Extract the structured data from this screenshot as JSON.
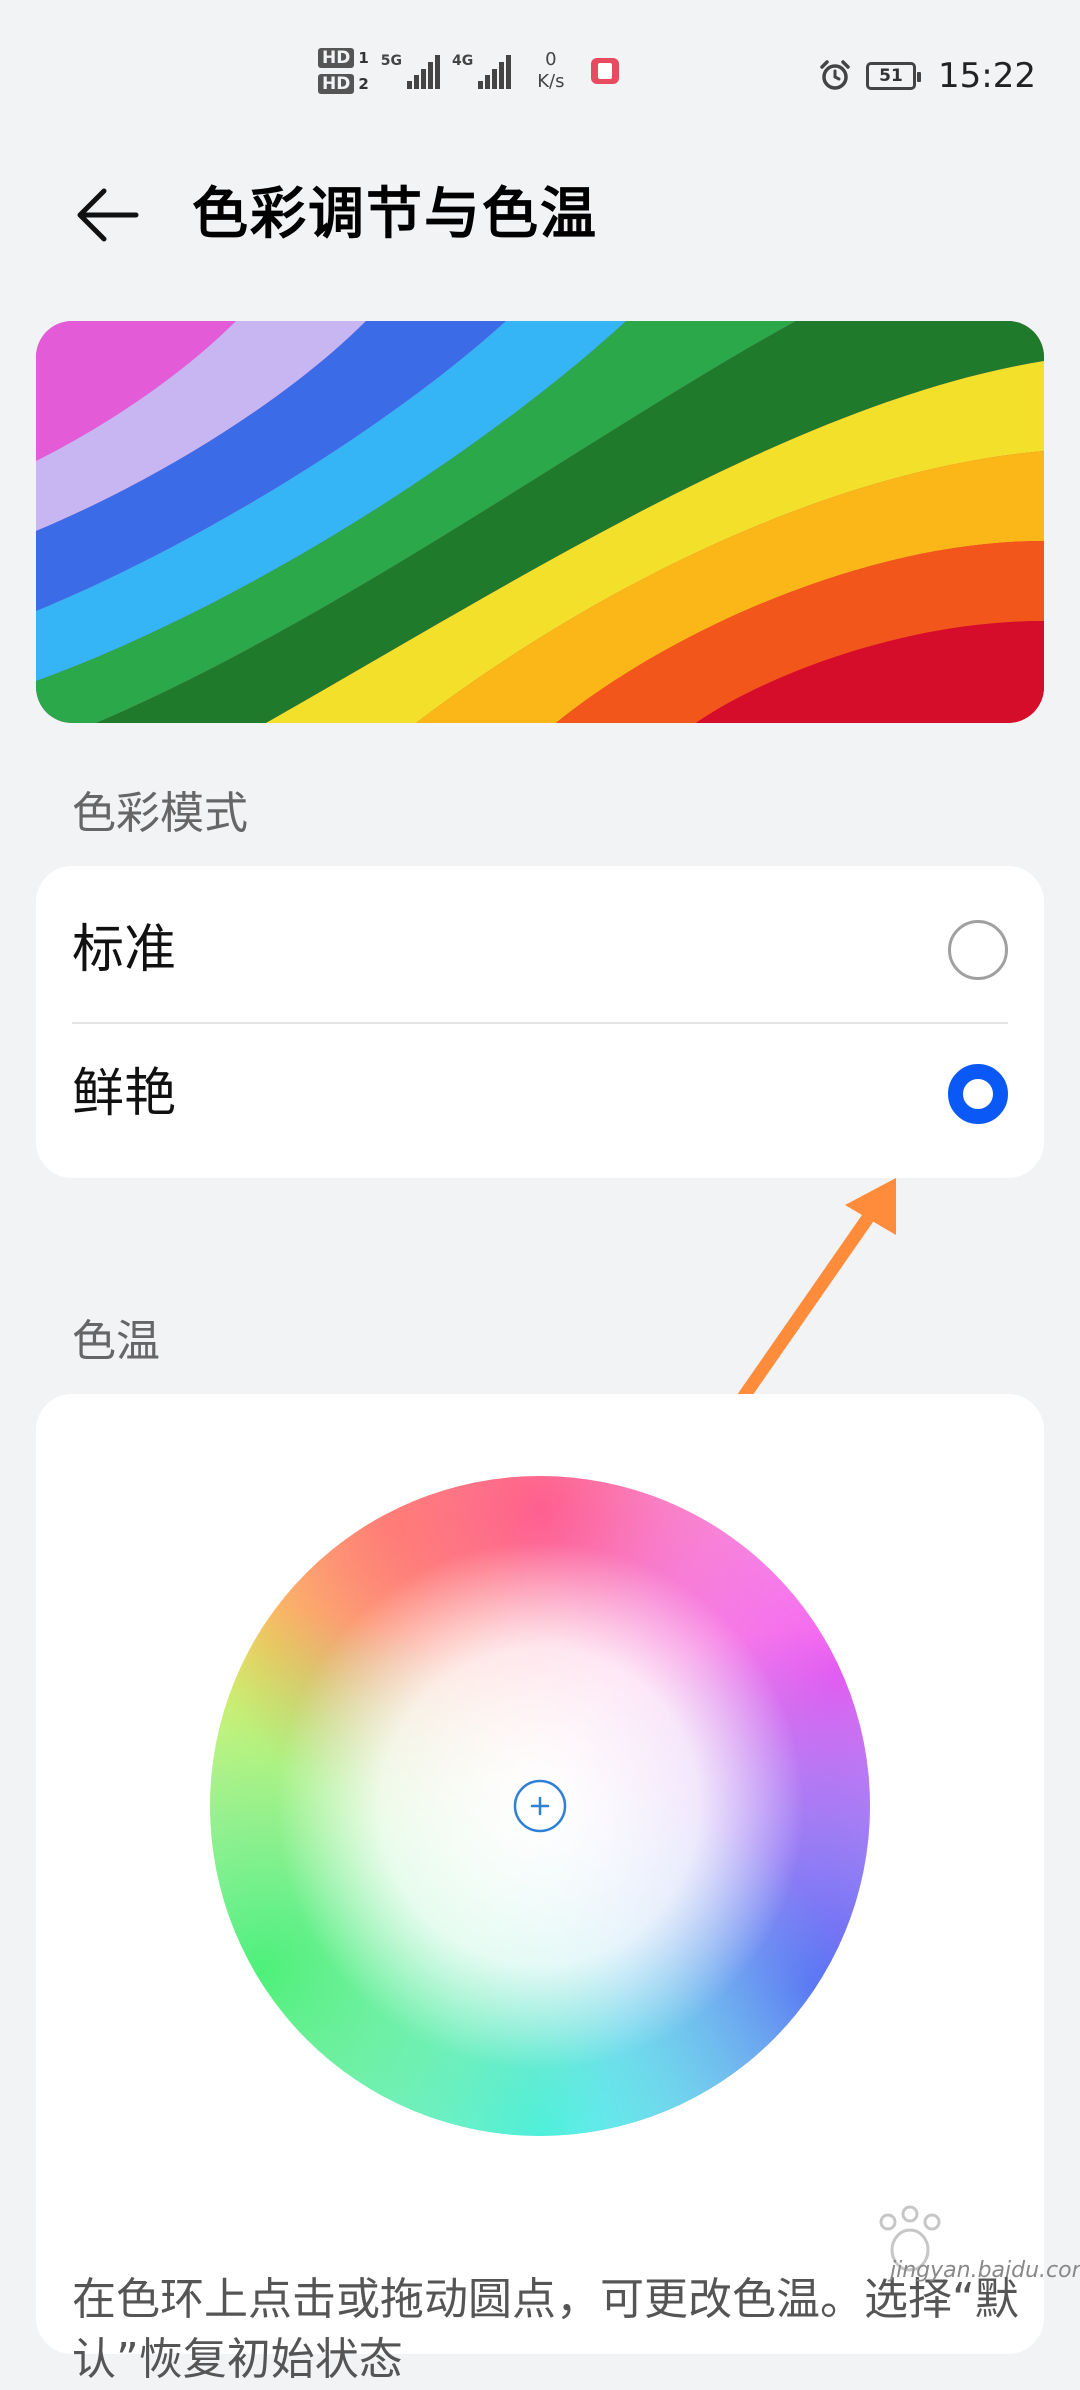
{
  "status_bar": {
    "sim1": "HD",
    "sim1_num": "1",
    "sim2": "HD",
    "sim2_num": "2",
    "net1": "5G",
    "net2": "4G",
    "speed_value": "0",
    "speed_unit": "K/s",
    "battery_level": "51",
    "time": "15:22"
  },
  "header": {
    "title": "色彩调节与色温",
    "back_icon": "arrow-left-icon"
  },
  "color_mode": {
    "label": "色彩模式",
    "options": [
      {
        "label": "标准",
        "selected": false
      },
      {
        "label": "鲜艳",
        "selected": true
      }
    ]
  },
  "color_temperature": {
    "label": "色温",
    "description": "在色环上点击或拖动圆点，可更改色温。选择“默认”恢复初始状态"
  },
  "watermark": {
    "text": "jingyan.baidu.com"
  },
  "colors": {
    "accent": "#0a59f7",
    "background": "#f1f3f5",
    "annotation_arrow": "#ff8c3a"
  }
}
